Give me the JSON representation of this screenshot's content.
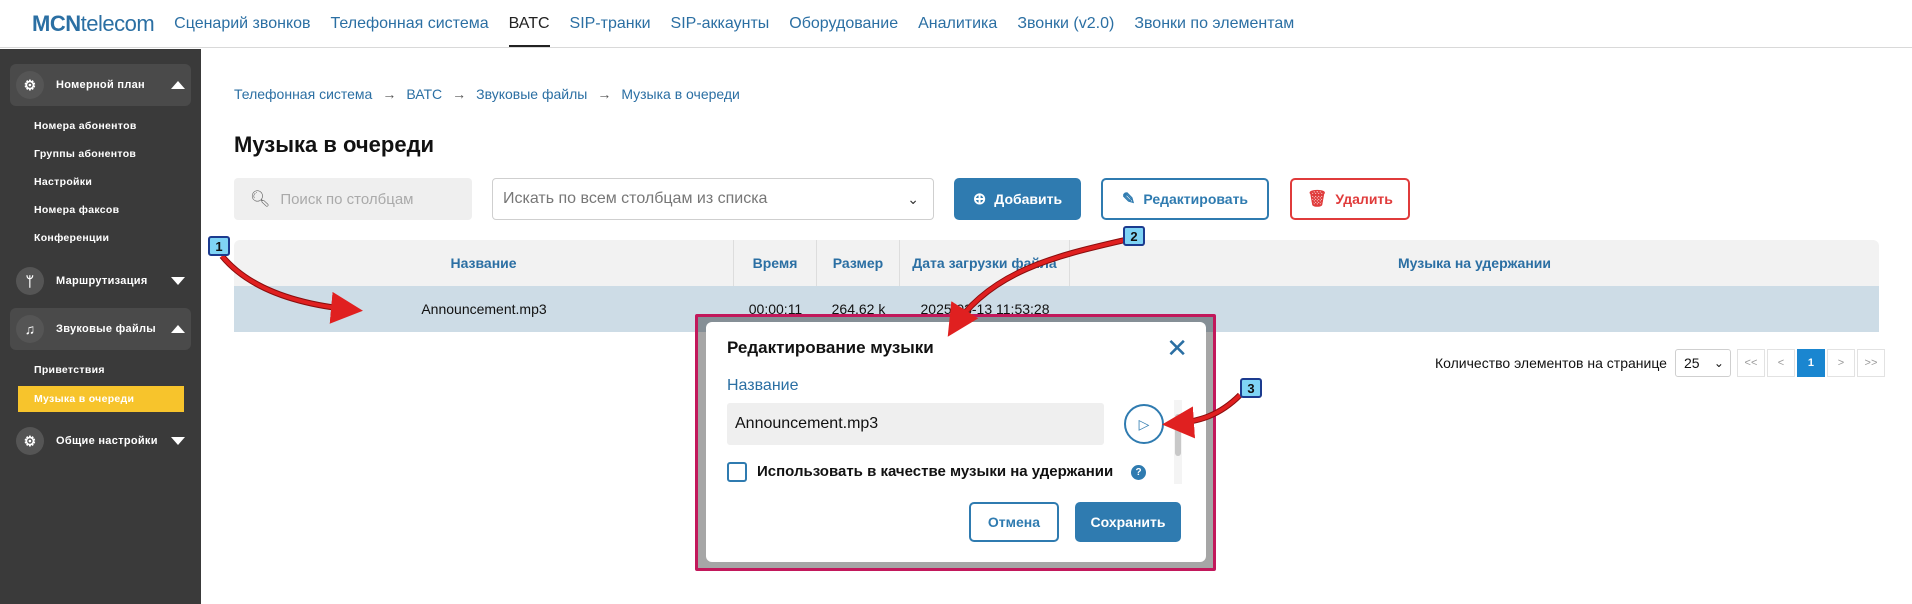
{
  "logo": {
    "brand": "MCN",
    "rest": "telecom"
  },
  "nav": [
    {
      "label": "Сценарий звонков"
    },
    {
      "label": "Телефонная система"
    },
    {
      "label": "ВАТС"
    },
    {
      "label": "SIP-транки"
    },
    {
      "label": "SIP-аккаунты"
    },
    {
      "label": "Оборудование"
    },
    {
      "label": "Аналитика"
    },
    {
      "label": "Звонки (v2.0)"
    },
    {
      "label": "Звонки по элементам"
    }
  ],
  "sidebar": {
    "groups": [
      {
        "label": "Номерной план",
        "icon": "gear-icon",
        "items": [
          "Номера абонентов",
          "Группы абонентов",
          "Настройки",
          "Номера факсов",
          "Конференции"
        ]
      },
      {
        "label": "Маршрутизация",
        "icon": "branch-icon"
      },
      {
        "label": "Звуковые файлы",
        "icon": "sound-file-icon",
        "items": [
          "Приветствия",
          "Музыка в очереди"
        ]
      },
      {
        "label": "Общие настройки",
        "icon": "gear-icon"
      }
    ]
  },
  "breadcrumb": [
    "Телефонная система",
    "ВАТС",
    "Звуковые файлы",
    "Музыка в очереди"
  ],
  "page_title": "Музыка в очереди",
  "search": {
    "placeholder": "Поиск по столбцам"
  },
  "column_select": {
    "value": "Искать по всем столбцам из списка"
  },
  "toolbar": {
    "add": "Добавить",
    "edit": "Редактировать",
    "delete": "Удалить"
  },
  "table": {
    "headers": [
      "Название",
      "Время",
      "Размер",
      "Дата загрузки файла",
      "Музыка на удержании"
    ],
    "rows": [
      {
        "name": "Announcement.mp3",
        "time": "00:00:11",
        "size": "264.62 k",
        "date": "2025-03-13 11:53:28",
        "hold": ""
      }
    ]
  },
  "pager": {
    "label": "Количество элементов на странице",
    "per_page": "25",
    "first": "<<",
    "prev": "<",
    "page": "1",
    "next": ">",
    "last": ">>"
  },
  "modal": {
    "title": "Редактирование музыки",
    "field_label": "Название",
    "field_value": "Announcement.mp3",
    "checkbox_label": "Использовать в качестве музыки на удержании",
    "help": "?",
    "cancel": "Отмена",
    "save": "Сохранить"
  },
  "badges": [
    "1",
    "2",
    "3"
  ],
  "colors": {
    "accent": "#2f7bb0",
    "danger": "#e03b3b",
    "active_sidebar": "#f7c42c",
    "highlight_frame": "#c2185b",
    "arrow": "#e02020"
  }
}
